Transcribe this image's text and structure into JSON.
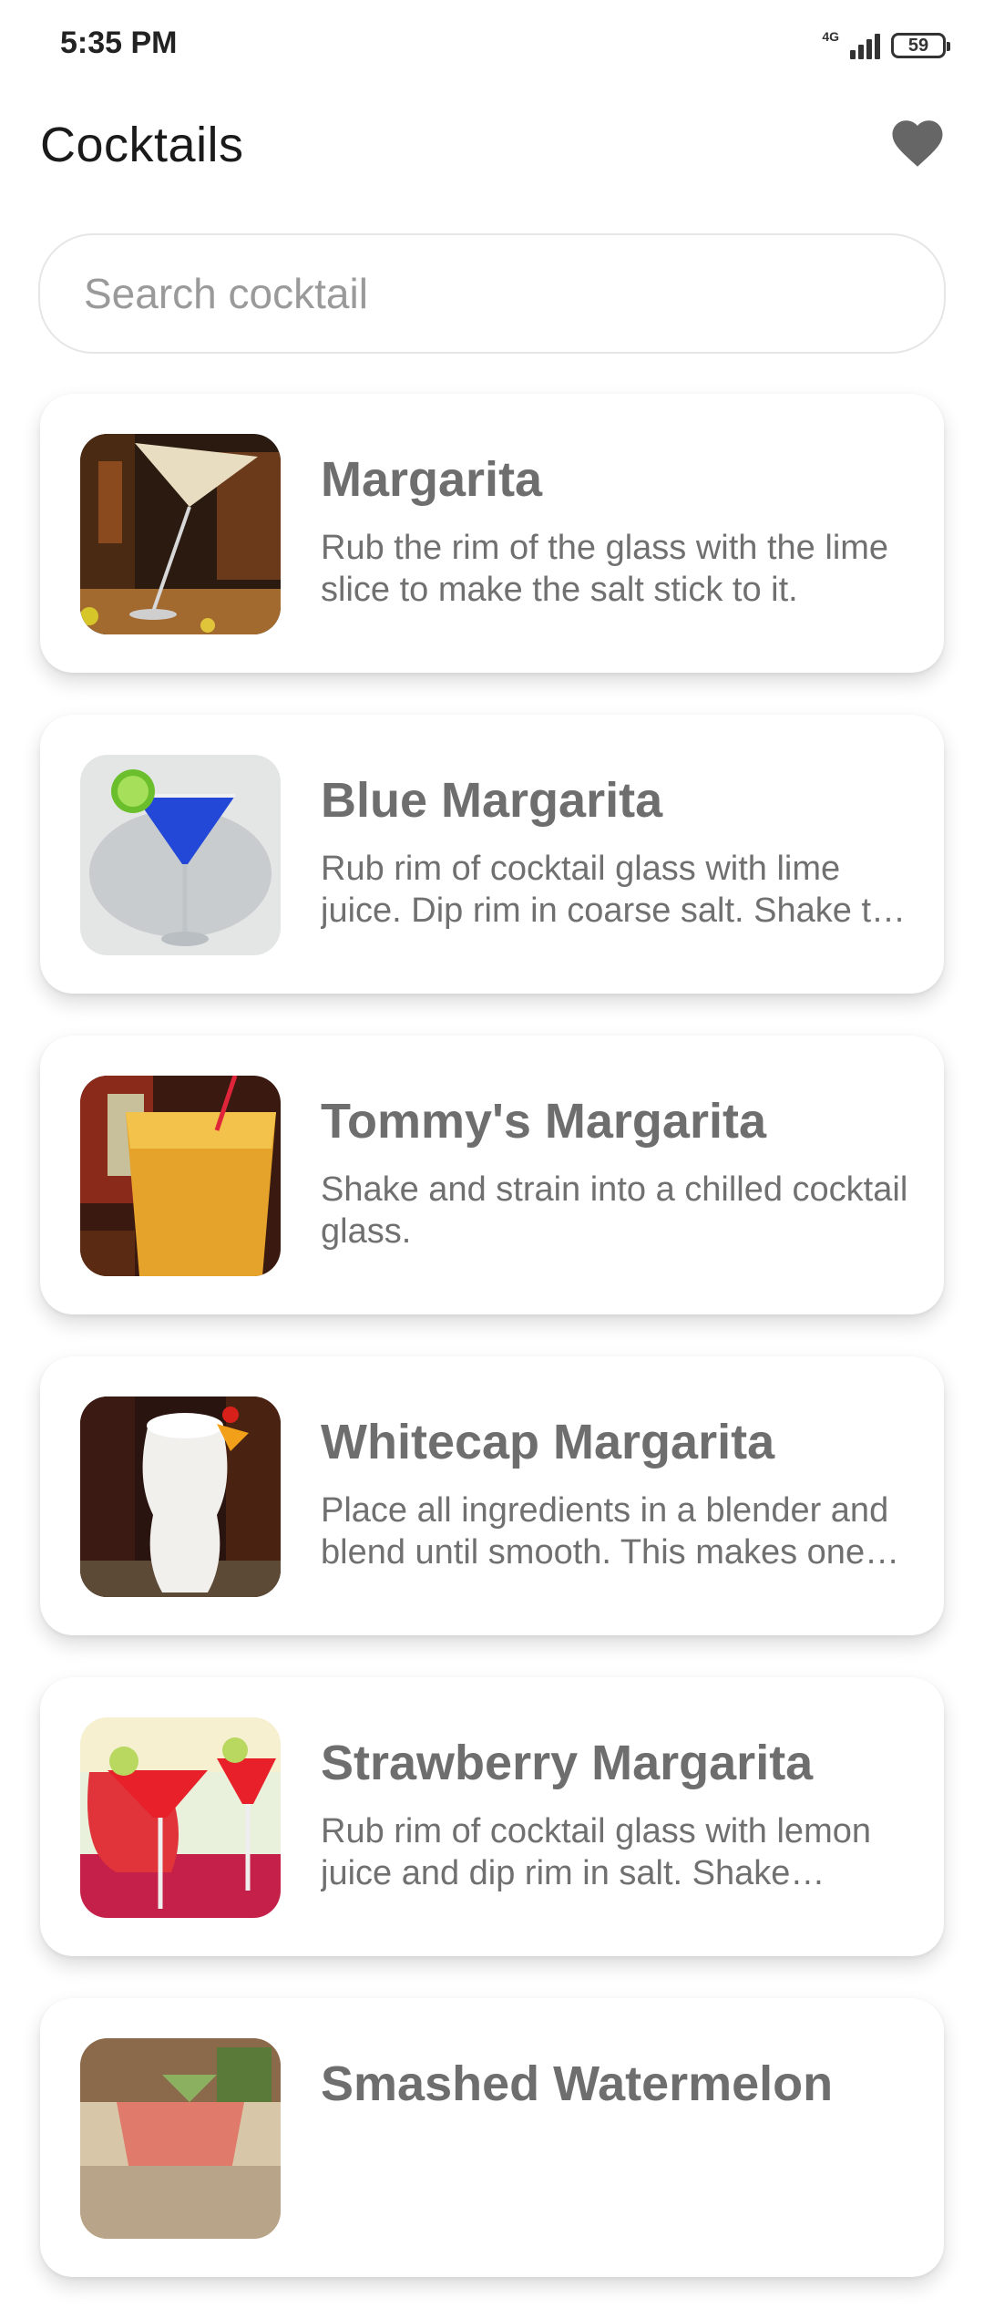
{
  "status_bar": {
    "time": "5:35 PM",
    "network": "4G",
    "battery": "59"
  },
  "header": {
    "title": "Cocktails",
    "favorites_icon": "heart-icon"
  },
  "search": {
    "placeholder": "Search cocktail",
    "value": ""
  },
  "cocktails": [
    {
      "name": "Margarita",
      "description": "Rub the rim of the glass with the lime slice to make the salt stick to it."
    },
    {
      "name": "Blue Margarita",
      "description": "Rub rim of cocktail glass with lime juice. Dip rim in coarse salt. Shake the other ingredients."
    },
    {
      "name": "Tommy's Margarita",
      "description": "Shake and strain into a chilled cocktail glass."
    },
    {
      "name": "Whitecap Margarita",
      "description": "Place all ingredients in a blender and blend until smooth. This makes one drink."
    },
    {
      "name": "Strawberry Margarita",
      "description": "Rub rim of cocktail glass with lemon juice and dip rim in salt. Shake schnapps."
    },
    {
      "name": "Smashed Watermelon",
      "description": ""
    }
  ]
}
